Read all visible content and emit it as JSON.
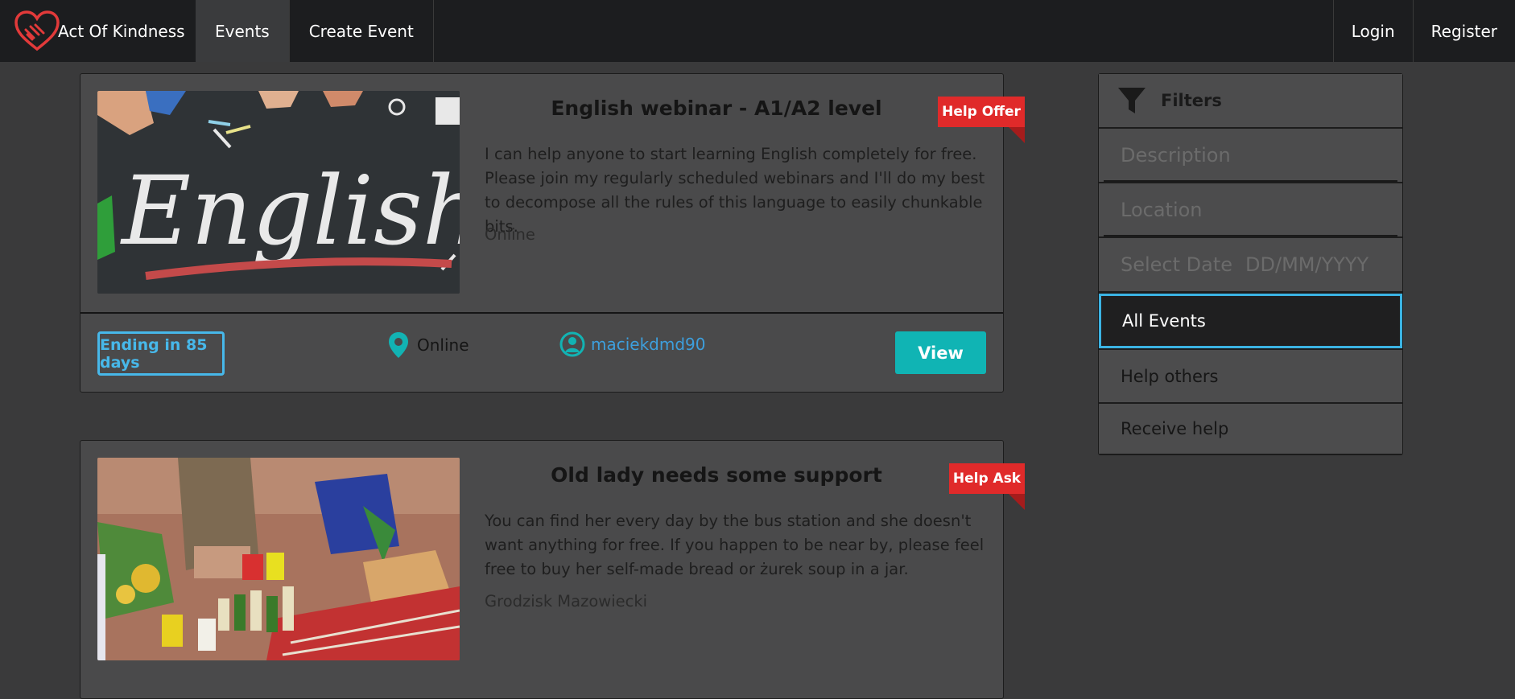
{
  "nav": {
    "brand": "Act Of Kindness",
    "links": [
      "Events",
      "Create Event"
    ],
    "right_links": [
      "Login",
      "Register"
    ]
  },
  "events": [
    {
      "title": "English webinar - A1/A2 level",
      "type": "Help Offer",
      "description": "I can help anyone to start learning English completely for free. Please join my regularly scheduled webinars and I'll do my best to decompose all the rules of this language to easily chunkable bits.",
      "location": "Online",
      "ending": "Ending in 85 days",
      "footer_location": "Online",
      "author": "maciekdmd90",
      "view_label": "View",
      "image_text": "English"
    },
    {
      "title": "Old lady needs some support",
      "type": "Help Ask",
      "description": "You can find her every day by the bus station and she doesn't want anything for free. If you happen to be near by, please feel free to buy her self-made bread or żurek soup in a jar.",
      "location": "Grodzisk Mazowiecki"
    }
  ],
  "filters": {
    "title": "Filters",
    "description_placeholder": "Description",
    "location_placeholder": "Location",
    "date_label": "Select Date",
    "date_placeholder": "DD/MM/YYYY",
    "options": [
      "All Events",
      "Help others",
      "Receive help"
    ],
    "selected": "All Events"
  },
  "colors": {
    "nav_bg": "#1c1d1f",
    "page_bg": "#3a3a3b",
    "card_bg": "#4a4a4b",
    "ribbon": "#e02a2a",
    "accent_blue": "#47b8ea",
    "view_button": "#10b4b4",
    "link": "#3d9fdd"
  }
}
